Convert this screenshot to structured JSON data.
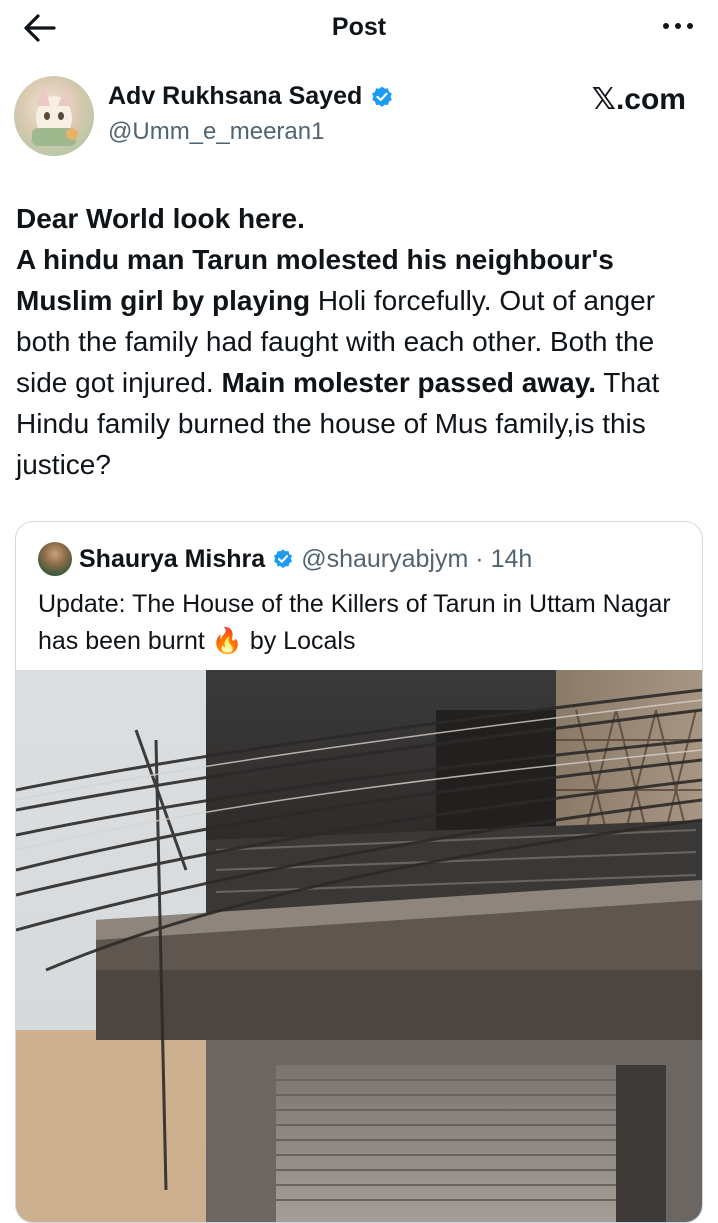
{
  "header": {
    "title": "Post",
    "back_icon": "arrow-left-icon",
    "more_icon": "ellipsis-icon"
  },
  "author": {
    "name": "Adv Rukhsana Sayed",
    "handle": "@Umm_e_meeran1",
    "verified": true,
    "verified_color": "#1d9bf0"
  },
  "watermark": "𝕏.com",
  "post": {
    "segments": [
      {
        "text": "Dear World look here.",
        "bold": true,
        "break": true
      },
      {
        "text": "A hindu man Tarun molested his neighbour's Muslim girl by playing",
        "bold": true
      },
      {
        "text": " Holi forcefully. Out of anger both the family had faught with each other. Both the side got injured. ",
        "bold": false
      },
      {
        "text": "Main molester passed away.",
        "bold": true
      },
      {
        "text": " That Hindu family burned the house of Mus family,is this justice?",
        "bold": false
      }
    ]
  },
  "quoted": {
    "name": "Shaurya Mishra",
    "handle": "@shauryabjym",
    "separator": "·",
    "time": "14h",
    "text_before": "Update: The House of the Killers of Tarun in Uttam Nagar has been burnt ",
    "emoji": "🔥",
    "text_after": " by Locals",
    "media": "photo-of-burnt-house"
  }
}
